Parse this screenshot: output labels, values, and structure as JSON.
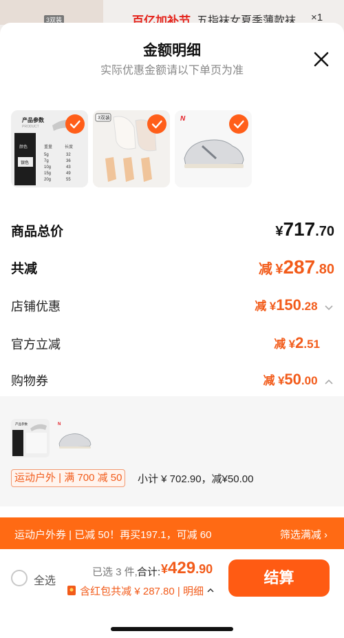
{
  "behind": {
    "tag": "3双装",
    "promo": "百亿加补节",
    "title": "五指袜女夏季薄款袜",
    "qty": "×1"
  },
  "sheet": {
    "title": "金额明细",
    "subtitle": "实际优惠金额请以下单页为准"
  },
  "products": [
    {
      "icon": "spec-table-image",
      "header": "产品参数",
      "header_en": "PRODUCT",
      "rows": [
        [
          "5g",
          "32"
        ],
        [
          "7g",
          "36"
        ],
        [
          "10g",
          "43"
        ],
        [
          "15g",
          "49"
        ],
        [
          "20g",
          "55"
        ]
      ],
      "col1": "重量",
      "col2": "长度",
      "side1": "颜色",
      "side2": "银色"
    },
    {
      "icon": "toe-socks-image",
      "tag": "3双装"
    },
    {
      "icon": "sneaker-image",
      "brand": "N"
    }
  ],
  "rows": {
    "total_label": "商品总价",
    "total_sym": "¥",
    "total_int": "717",
    "total_dec": ".70",
    "reduce_label": "共减",
    "reduce_prefix": "减",
    "reduce_sym": "¥",
    "reduce_int": "287",
    "reduce_dec": ".80",
    "store_label": "店铺优惠",
    "store_prefix": "减",
    "store_sym": "¥",
    "store_int": "150",
    "store_dec": ".28",
    "official_label": "官方立减",
    "official_prefix": "减",
    "official_sym": "¥",
    "official_int": "2",
    "official_dec": ".51",
    "coupon_label": "购物券",
    "coupon_prefix": "减",
    "coupon_sym": "¥",
    "coupon_int": "50",
    "coupon_dec": ".00"
  },
  "store_section": {
    "mini_header": "产品参数",
    "chip": "运动户外 | 满 700 减 50",
    "subtotal": "小计 ¥ 702.90，减¥50.00"
  },
  "banner": {
    "text": "运动户外券 | 已减 50！再买197.1，可减 60",
    "filter": "筛选满减 ›"
  },
  "footer": {
    "select_all": "全选",
    "selected": "已选 3 件,",
    "total_label": "合计:",
    "total_sym": "¥",
    "total_int": "429",
    "total_dec": ".90",
    "red_packet": "含红包共减 ¥ 287.80 | 明细",
    "checkout": "结算"
  },
  "colors": {
    "accent": "#ff5b13",
    "price": "#f25b1a",
    "check": "#ff5e19"
  }
}
